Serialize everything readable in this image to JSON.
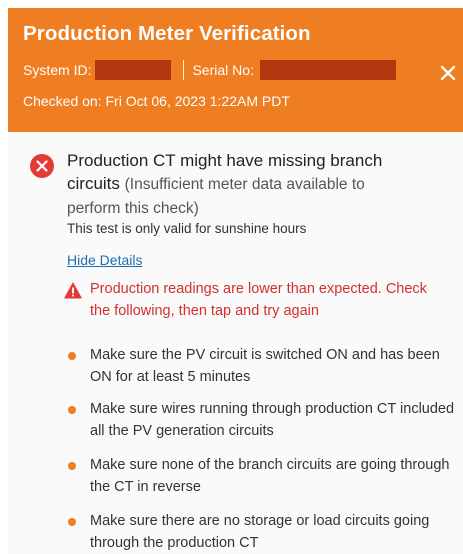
{
  "header": {
    "title": "Production Meter Verification",
    "system_id_label": "System ID:",
    "serial_label": "Serial No:",
    "checked_on": "Checked on: Fri Oct 06, 2023 1:22AM PDT"
  },
  "icons": {
    "close": "close-icon",
    "error": "error-icon",
    "warning": "warning-icon",
    "bullet": "bullet-dot"
  },
  "colors": {
    "header_bg": "#ef7d22",
    "error_red": "#e53935",
    "warning_red": "#d32f2f",
    "link_blue": "#1a6fb3",
    "bullet_orange": "#ef7d22",
    "redaction": "#b4360f"
  },
  "check": {
    "heading_main": "Production CT might have missing branch circuits",
    "heading_sub": "(Insufficient meter data available to perform this check)",
    "validity_note": "This test is only valid for sunshine hours",
    "hide_details_link": "Hide Details",
    "warning_message": "Production readings are lower than expected. Check the following, then tap and try again",
    "steps": [
      "Make sure the PV circuit is switched ON and has been ON for at least 5 minutes",
      "Make sure wires running through production CT included all the PV generation circuits",
      "Make sure none of the branch circuits are going through the CT in reverse",
      "Make sure there are no storage or load circuits going through the production CT"
    ]
  }
}
